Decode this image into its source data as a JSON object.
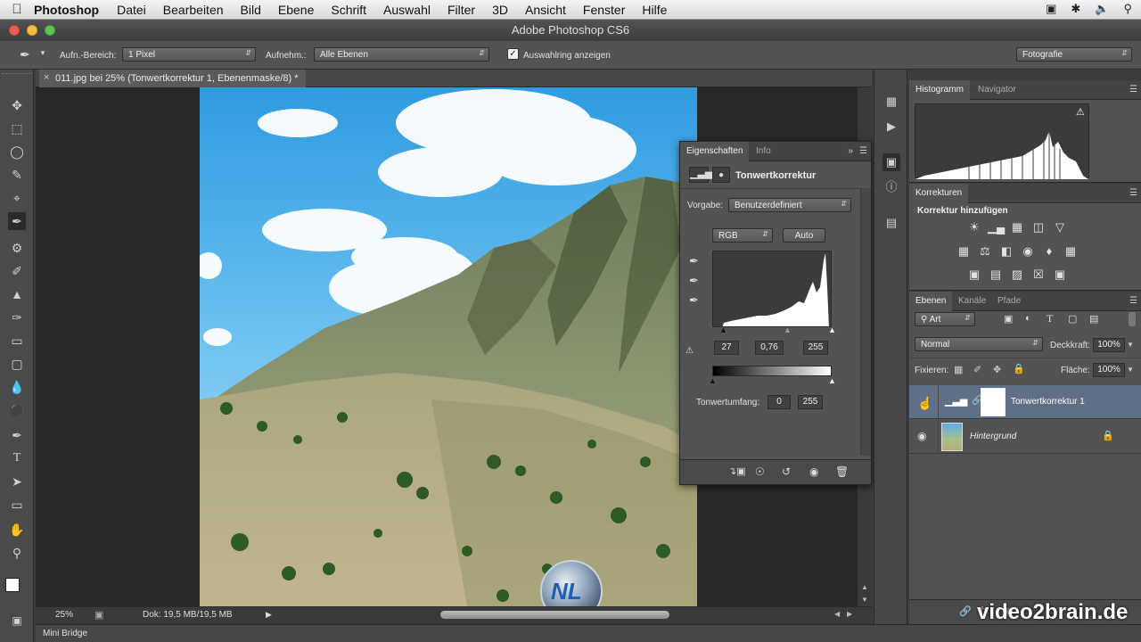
{
  "menubar": {
    "app": "Photoshop",
    "items": [
      "Datei",
      "Bearbeiten",
      "Bild",
      "Ebene",
      "Schrift",
      "Auswahl",
      "Filter",
      "3D",
      "Ansicht",
      "Fenster",
      "Hilfe"
    ]
  },
  "window": {
    "title": "Adobe Photoshop CS6"
  },
  "options": {
    "sample_size_label": "Aufn.-Bereich:",
    "sample_size_value": "1 Pixel",
    "sample_label": "Aufnehm.:",
    "sample_value": "Alle Ebenen",
    "show_ring_label": "Auswahlring anzeigen",
    "workspace": "Fotografie"
  },
  "document": {
    "tab_title": "011.jpg bei 25% (Tonwertkorrektur 1, Ebenenmaske/8) *",
    "zoom": "25%",
    "doc_info": "Dok: 19,5 MB/19,5 MB"
  },
  "properties": {
    "tab_props": "Eigenschaften",
    "tab_info": "Info",
    "title": "Tonwertkorrektur",
    "preset_label": "Vorgabe:",
    "preset_value": "Benutzerdefiniert",
    "channel": "RGB",
    "auto": "Auto",
    "input_black": "27",
    "input_gamma": "0,76",
    "input_white": "255",
    "output_label": "Tonwertumfang:",
    "output_black": "0",
    "output_white": "255"
  },
  "histogram_panel": {
    "tab_hist": "Histogramm",
    "tab_nav": "Navigator"
  },
  "adjustments": {
    "tab": "Korrekturen",
    "title": "Korrektur hinzufügen"
  },
  "layers": {
    "tab_layers": "Ebenen",
    "tab_channels": "Kanäle",
    "tab_paths": "Pfade",
    "filter": "Art",
    "blend_mode": "Normal",
    "opacity_label": "Deckkraft:",
    "opacity": "100%",
    "lock_label": "Fixieren:",
    "fill_label": "Fläche:",
    "fill": "100%",
    "items": [
      {
        "name": "Tonwertkorrektur 1"
      },
      {
        "name": "Hintergrund"
      }
    ]
  },
  "bottom": {
    "mini_bridge": "Mini Bridge",
    "watermark": "video2brain.de"
  }
}
